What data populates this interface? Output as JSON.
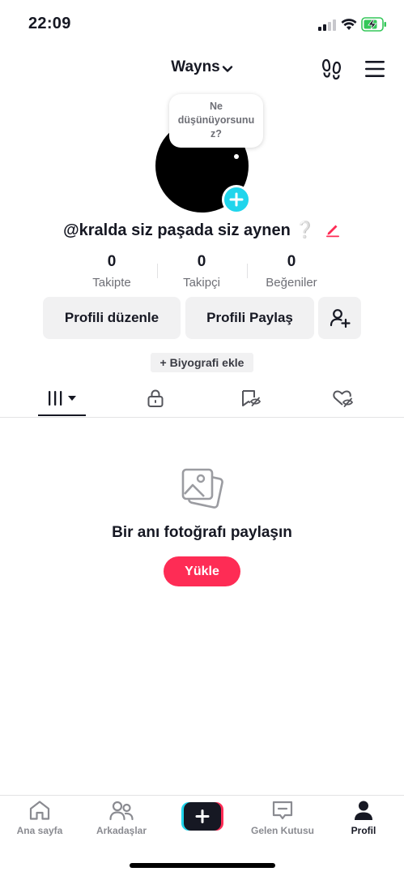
{
  "status_bar": {
    "time": "22:09"
  },
  "header": {
    "username": "Wayns"
  },
  "bubble": {
    "text": "Ne düşünüyorsunuz?"
  },
  "profile": {
    "handle": "@kralda siz paşada siz aynen",
    "handle_emoji": "❔"
  },
  "stats": [
    {
      "number": "0",
      "label": "Takipte"
    },
    {
      "number": "0",
      "label": "Takipçi"
    },
    {
      "number": "0",
      "label": "Beğeniler"
    }
  ],
  "buttons": {
    "edit_profile": "Profili düzenle",
    "share_profile": "Profili Paylaş"
  },
  "bio_button": "+ Biyografi ekle",
  "empty_state": {
    "title": "Bir anı fotoğrafı paylaşın",
    "upload": "Yükle"
  },
  "nav": {
    "home": "Ana sayfa",
    "friends": "Arkadaşlar",
    "inbox": "Gelen Kutusu",
    "profile": "Profil"
  },
  "colors": {
    "accent": "#fe2c55",
    "cyan": "#20d5ec",
    "text": "#161823",
    "muted": "#6e6f76"
  }
}
